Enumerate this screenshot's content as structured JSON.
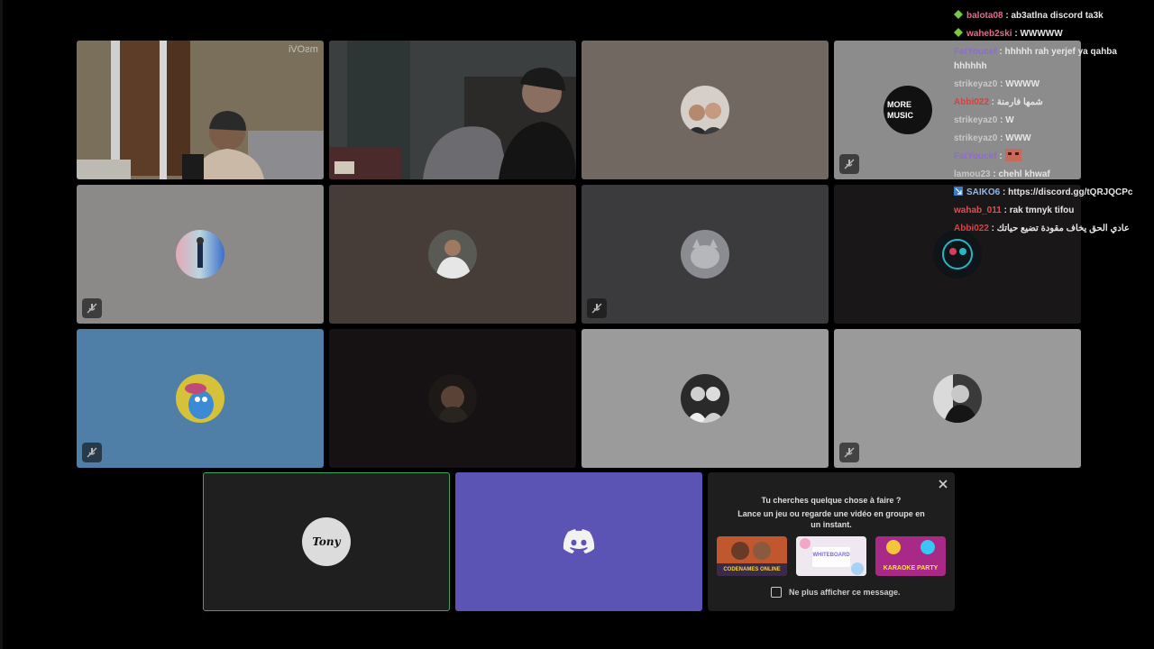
{
  "colors": {
    "background": "#000000",
    "tile_border_active": "#3ba55d",
    "discord_blurple": "#5865f2",
    "chat_text": "#e6e6e6"
  },
  "tiles": [
    {
      "id": "cam-1",
      "kind": "video",
      "watermark": "msOVi"
    },
    {
      "id": "cam-2",
      "kind": "video"
    },
    {
      "id": "avatar-couple",
      "kind": "avatar",
      "muted": false
    },
    {
      "id": "avatar-more-music",
      "kind": "avatar",
      "muted": true
    },
    {
      "id": "avatar-figure",
      "kind": "avatar",
      "muted": true
    },
    {
      "id": "avatar-man-white",
      "kind": "avatar",
      "muted": false
    },
    {
      "id": "avatar-cat",
      "kind": "avatar",
      "muted": true
    },
    {
      "id": "avatar-neon",
      "kind": "avatar",
      "muted": false
    },
    {
      "id": "avatar-blue-character",
      "kind": "avatar",
      "muted": true
    },
    {
      "id": "avatar-dark-man",
      "kind": "avatar",
      "muted": false
    },
    {
      "id": "avatar-bw-pair",
      "kind": "avatar",
      "muted": false
    },
    {
      "id": "avatar-bw-portrait",
      "kind": "avatar",
      "muted": true
    }
  ],
  "bottom": {
    "self_tile": {
      "avatar_text": "Tony"
    },
    "discord_tile": {
      "icon": "discord-logo-icon"
    },
    "promo": {
      "title": "Tu cherches quelque chose à faire ?",
      "body": "Lance un jeu ou regarde une vidéo en groupe en un instant.",
      "activities": [
        {
          "name": "Codenames Online",
          "label": "CODENAMES ONLINE"
        },
        {
          "name": "Whiteboard",
          "label": "WHITEBOARD"
        },
        {
          "name": "Karaoke Party",
          "label": "KARAOKE PARTY"
        }
      ],
      "checkbox_label": "Ne plus afficher ce message."
    }
  },
  "chat": [
    {
      "badge": "green-diamond-icon",
      "user": "balota08",
      "user_color": "#e86a8a",
      "sep": " : ",
      "text": "ab3atlna discord ta3k"
    },
    {
      "badge": "green-diamond-icon",
      "user": "waheb2ski",
      "user_color": "#e86a8a",
      "sep": " : ",
      "text": "WWWWW"
    },
    {
      "badge": "",
      "user": "FatYoucef",
      "user_color": "#8f6ad8",
      "sep": " : ",
      "text": "hhhhh rah yerjef ya qahba"
    },
    {
      "badge": "",
      "user": "",
      "user_color": "#e6e6e6",
      "sep": "",
      "text": "hhhhhh"
    },
    {
      "badge": "",
      "user": "strikeyaz0",
      "user_color": "#c8c8c8",
      "sep": " : ",
      "text": "WWWW"
    },
    {
      "badge": "",
      "user": "Abbi022",
      "user_color": "#d94040",
      "sep": " : ",
      "text": "شمها فارمنة"
    },
    {
      "badge": "",
      "user": "strikeyaz0",
      "user_color": "#c8c8c8",
      "sep": " : ",
      "text": "W"
    },
    {
      "badge": "",
      "user": "strikeyaz0",
      "user_color": "#c8c8c8",
      "sep": " : ",
      "text": "WWW"
    },
    {
      "badge": "",
      "user": "FatYoucef",
      "user_color": "#8f6ad8",
      "sep": " : ",
      "text": ""
    },
    {
      "badge": "",
      "user": "lamou23",
      "user_color": "#c8c8c8",
      "sep": " : ",
      "text": "chehl khwaf"
    },
    {
      "badge": "blue-arrow-icon",
      "user": "SAIKO6",
      "user_color": "#8fb8e8",
      "sep": " : ",
      "text": "https://discord.gg/tQRJQCPc"
    },
    {
      "badge": "",
      "user": "wahab_011",
      "user_color": "#e05050",
      "sep": " : ",
      "text": "rak tmnyk tifou"
    },
    {
      "badge": "",
      "user": "Abbi022",
      "user_color": "#d94040",
      "sep": " : ",
      "text": "عادي الحق يخاف مقودة تضيع حياتك"
    }
  ]
}
